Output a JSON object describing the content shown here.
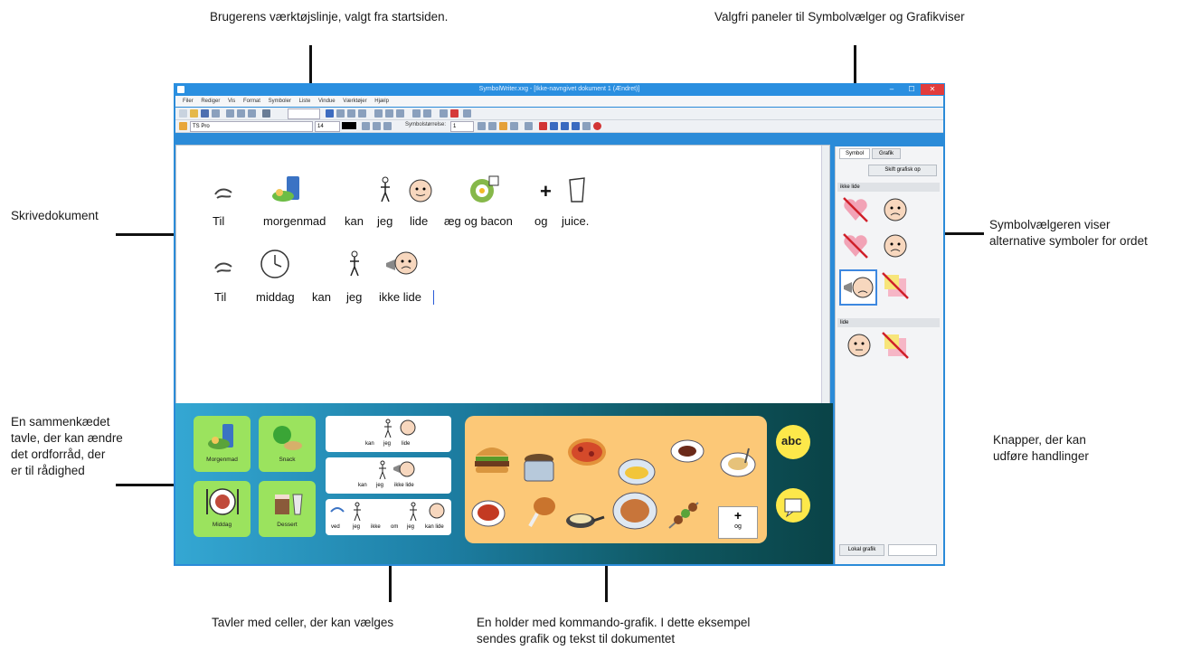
{
  "annotations": {
    "toolbar": "Brugerens værktøjslinje, valgt fra startsiden.",
    "panels": "Valgfri paneler til Symbolvælger og Grafikviser",
    "document": "Skrivedokument",
    "symbol_chooser_line1": "Symbolvælgeren viser",
    "symbol_chooser_line2": "alternative symboler for ordet",
    "linked_grid_line1": "En sammenkædet",
    "linked_grid_line2": "tavle, der kan ændre",
    "linked_grid_line3": "det ordforråd, der",
    "linked_grid_line4": "er til rådighed",
    "buttons_line1": "Knapper, der kan",
    "buttons_line2": "udføre handlinger",
    "cell_grids": "Tavler med celler, der kan vælges",
    "holder_line1": "En holder med kommando-grafik. I dette eksempel",
    "holder_line2": "sendes grafik og tekst til dokumentet"
  },
  "window": {
    "title": "SymbolWriter.xxg - [Ikke-navngivet dokument 1 (Ændret)]",
    "minimize": "–",
    "maximize": "☐",
    "close": "✕"
  },
  "menu": [
    "Filer",
    "Rediger",
    "Vis",
    "Format",
    "Symboler",
    "Liste",
    "Vindue",
    "Værktøjer",
    "Hjælp"
  ],
  "toolbar2": {
    "font": "TS Pro",
    "size": "14",
    "symbol_size_label": "Symbolstørrelse:",
    "symbol_size_value": "1"
  },
  "document": {
    "line1": [
      "Til",
      "morgenmad",
      "kan",
      "jeg",
      "lide",
      "æg og bacon",
      "og",
      "juice."
    ],
    "line2": [
      "Til",
      "middag",
      "kan",
      "jeg",
      "ikke lide"
    ]
  },
  "side_panel": {
    "tab_symbols": "Symbol",
    "tab_graphics": "Grafik",
    "button": "Skift grafisk op",
    "section1": "ikke lide",
    "section2": "lide",
    "bottom_label": "Lokal grafik"
  },
  "tray": {
    "categories": [
      "Morgenmad",
      "Snack",
      "Middag",
      "Dessert"
    ],
    "word_cell1": [
      "kan",
      "jeg",
      "lide"
    ],
    "word_cell2": [
      "kan",
      "jeg",
      "ikke lide"
    ],
    "word_cell3": [
      "ved",
      "jeg",
      "ikke",
      "om",
      "jeg",
      "kan lide"
    ],
    "plus_cell": {
      "symbol": "+",
      "label": "og"
    },
    "abc_button": "abc"
  },
  "colors": {
    "titlebar": "#2a8fe0",
    "tray_start": "#34a7d3",
    "tray_end": "#0a4347",
    "holder": "#fcc877",
    "category_cell": "#9be35e",
    "action_button": "#fde84a",
    "close_button": "#e23c3c"
  }
}
